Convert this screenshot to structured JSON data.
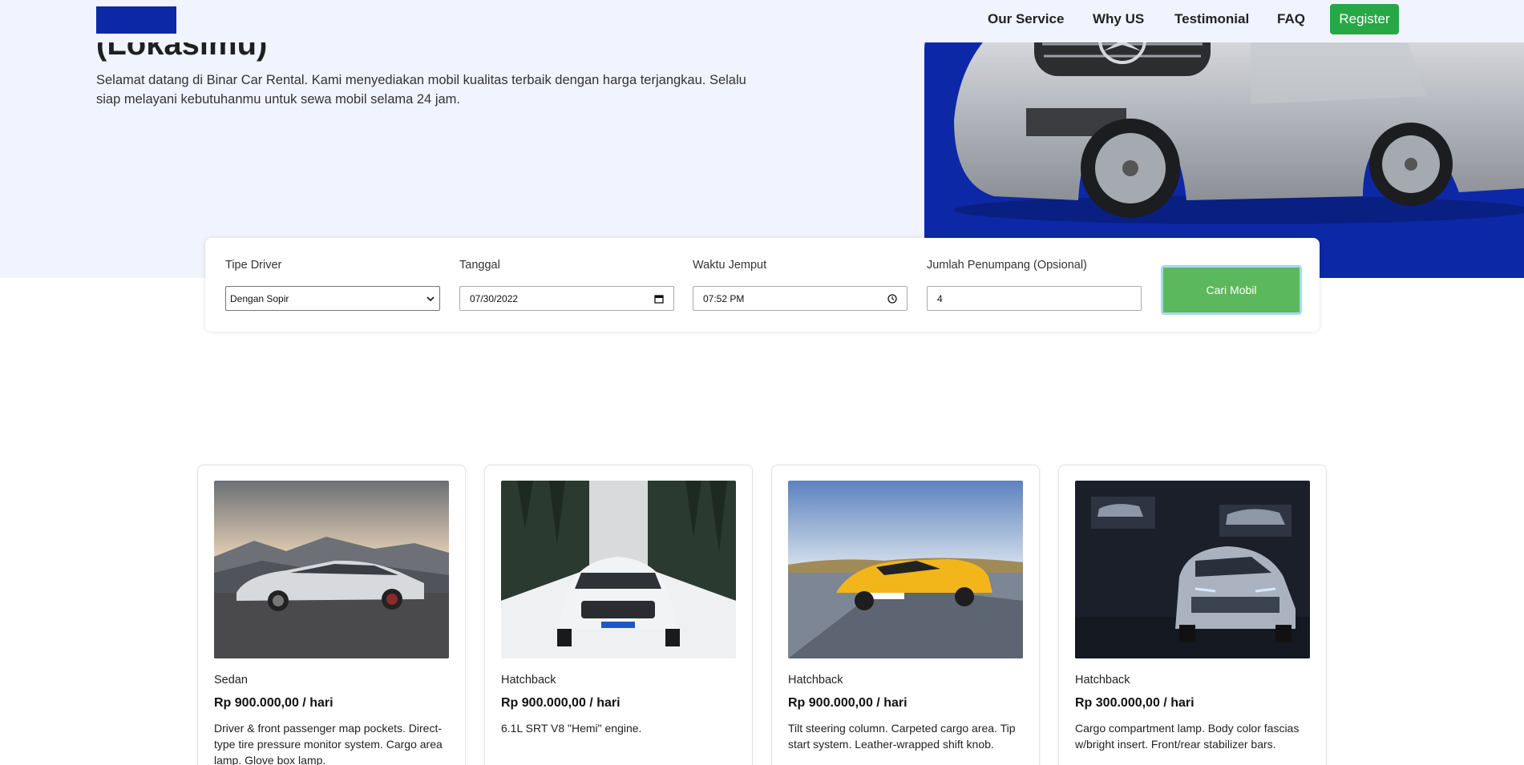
{
  "hero": {
    "title": "(Lokasimu)",
    "description": "Selamat datang di Binar Car Rental. Kami menyediakan mobil kualitas terbaik dengan harga terjangkau. Selalu siap melayani kebutuhanmu untuk sewa mobil selama 24 jam."
  },
  "navbar": {
    "links": [
      "Our Service",
      "Why US",
      "Testimonial",
      "FAQ"
    ],
    "register_label": "Register"
  },
  "search": {
    "fields": [
      {
        "label": "Tipe Driver",
        "value": "Dengan Sopir",
        "icon": "chevron-down-icon"
      },
      {
        "label": "Tanggal",
        "value": "07/30/2022",
        "icon": "calendar-icon"
      },
      {
        "label": "Waktu Jemput",
        "value": "07:52 PM",
        "icon": "clock-icon"
      },
      {
        "label": "Jumlah Penumpang (Opsional)",
        "value": "4"
      }
    ],
    "button_label": "Cari Mobil"
  },
  "cars": [
    {
      "type": "Sedan",
      "price": "Rp 900.000,00 / hari",
      "description": "Driver & front passenger map pockets. Direct-type tire pressure monitor system. Cargo area lamp. Glove box lamp."
    },
    {
      "type": "Hatchback",
      "price": "Rp 900.000,00 / hari",
      "description": "6.1L SRT V8 \"Hemi\" engine."
    },
    {
      "type": "Hatchback",
      "price": "Rp 900.000,00 / hari",
      "description": "Tilt steering column. Carpeted cargo area. Tip start system. Leather-wrapped shift knob."
    },
    {
      "type": "Hatchback",
      "price": "Rp 300.000,00 / hari",
      "description": "Cargo compartment lamp. Body color fascias w/bright insert. Front/rear stabilizer bars."
    }
  ],
  "colors": {
    "brand_blue": "#0d28a6",
    "hero_bg": "#f1f3fe",
    "register_green": "#28a745",
    "search_green": "#5cb85c"
  }
}
